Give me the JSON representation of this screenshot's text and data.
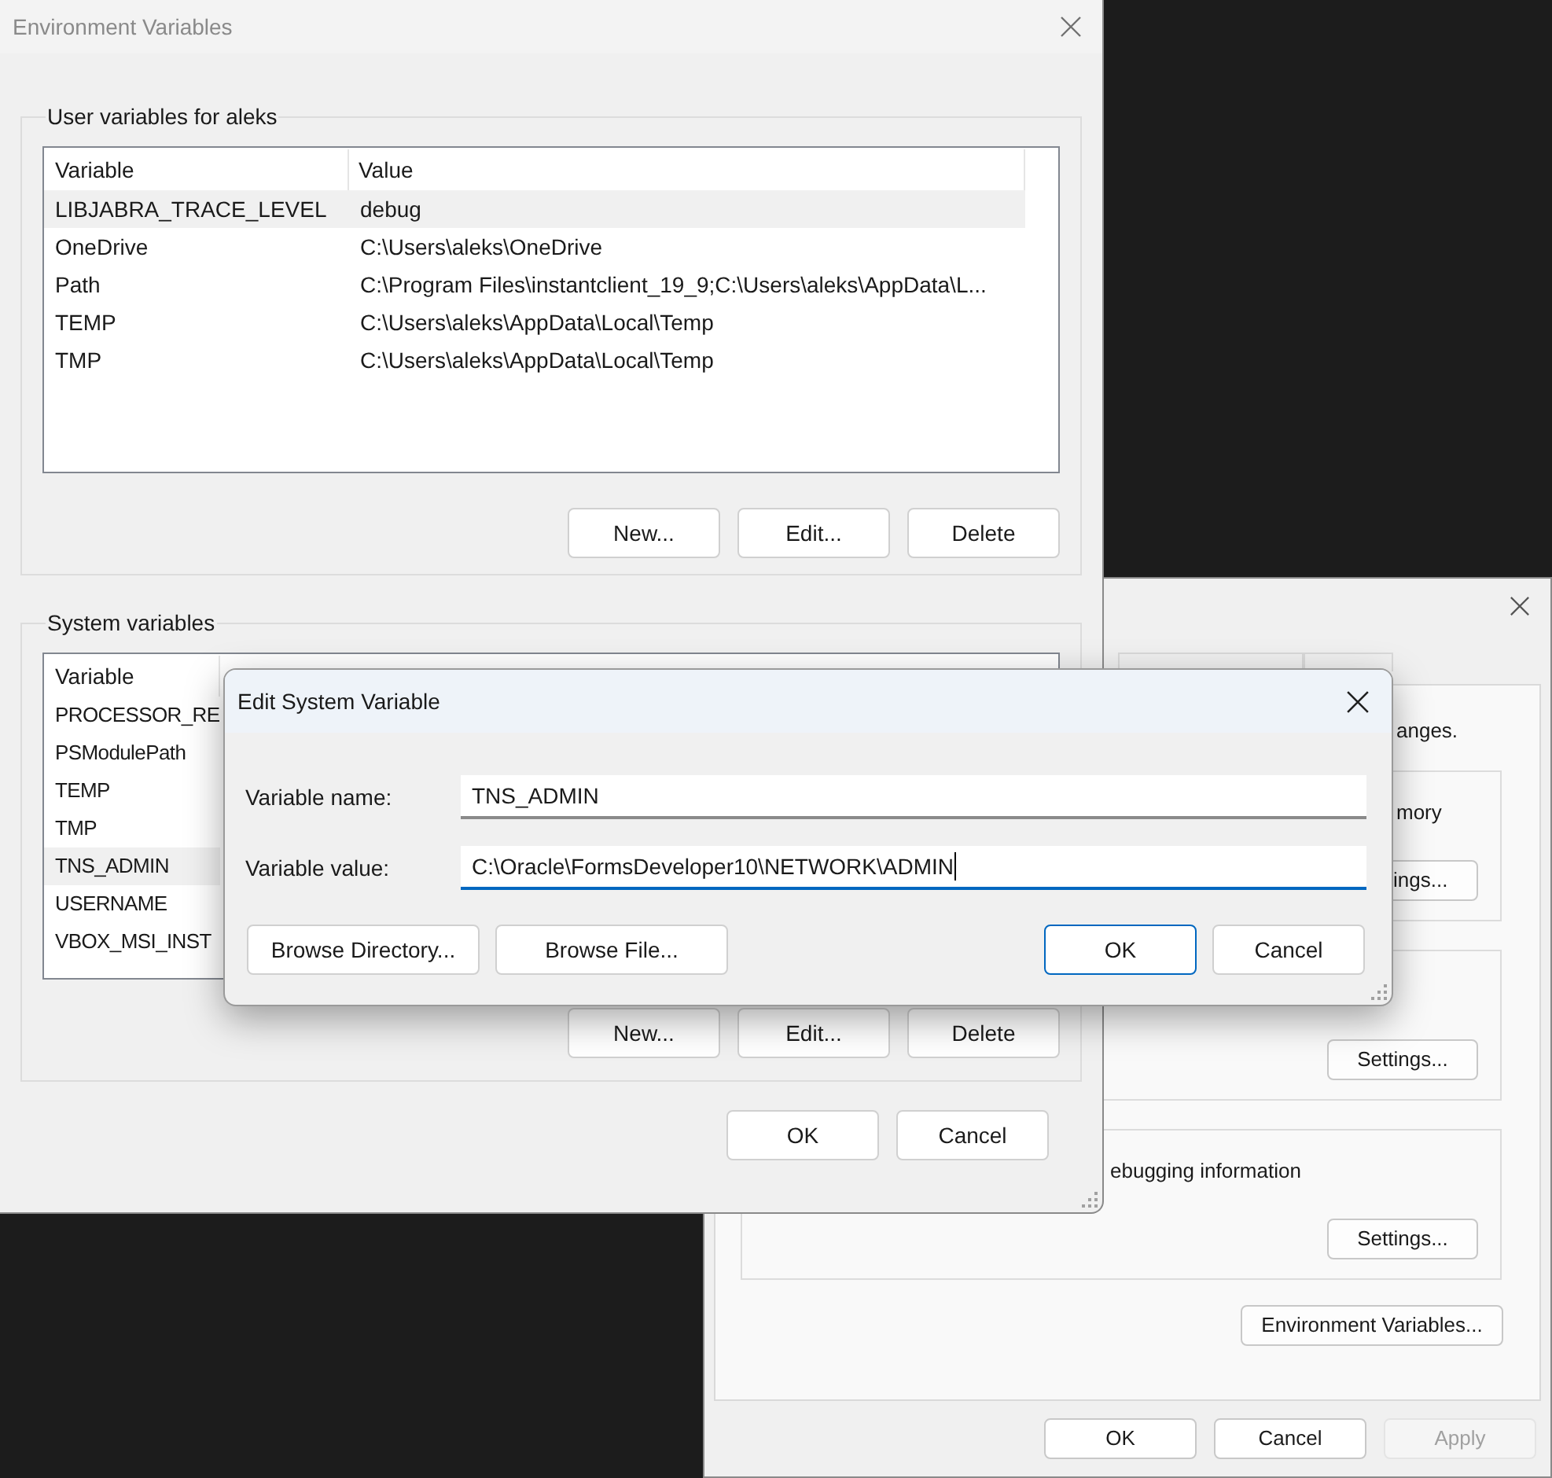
{
  "env_window": {
    "title": "Environment Variables",
    "user_group": {
      "label": "User variables for aleks",
      "columns": [
        "Variable",
        "Value"
      ],
      "rows": [
        {
          "variable": "LIBJABRA_TRACE_LEVEL",
          "value": "debug",
          "selected": true
        },
        {
          "variable": "OneDrive",
          "value": "C:\\Users\\aleks\\OneDrive",
          "selected": false
        },
        {
          "variable": "Path",
          "value": "C:\\Program Files\\instantclient_19_9;C:\\Users\\aleks\\AppData\\L...",
          "selected": false
        },
        {
          "variable": "TEMP",
          "value": "C:\\Users\\aleks\\AppData\\Local\\Temp",
          "selected": false
        },
        {
          "variable": "TMP",
          "value": "C:\\Users\\aleks\\AppData\\Local\\Temp",
          "selected": false
        }
      ],
      "buttons": [
        "New...",
        "Edit...",
        "Delete"
      ]
    },
    "system_group": {
      "label": "System variables",
      "columns": [
        "Variable"
      ],
      "rows": [
        {
          "variable": "PROCESSOR_RE",
          "selected": false
        },
        {
          "variable": "PSModulePath",
          "selected": false
        },
        {
          "variable": "TEMP",
          "selected": false
        },
        {
          "variable": "TMP",
          "selected": false
        },
        {
          "variable": "TNS_ADMIN",
          "selected": true
        },
        {
          "variable": "USERNAME",
          "selected": false
        },
        {
          "variable": "VBOX_MSI_INST",
          "selected": false
        }
      ],
      "buttons": [
        "New...",
        "Edit...",
        "Delete"
      ]
    },
    "buttons": [
      "OK",
      "Cancel"
    ]
  },
  "back_window": {
    "intro_text": "anges.",
    "groups": [
      {
        "text": "mory",
        "button": "ings..."
      },
      {
        "button": "Settings..."
      },
      {
        "text": "ebugging information",
        "button": "Settings..."
      }
    ],
    "env_button": "Environment Variables...",
    "buttons": [
      {
        "label": "OK",
        "disabled": false
      },
      {
        "label": "Cancel",
        "disabled": false
      },
      {
        "label": "Apply",
        "disabled": true
      }
    ]
  },
  "edit_dialog": {
    "title": "Edit System Variable",
    "fields": [
      {
        "label": "Variable name:",
        "value": "TNS_ADMIN",
        "focused": false
      },
      {
        "label": "Variable value:",
        "value": "C:\\Oracle\\FormsDeveloper10\\NETWORK\\ADMIN",
        "focused": true
      }
    ],
    "browse_buttons": [
      "Browse Directory...",
      "Browse File..."
    ],
    "buttons": [
      {
        "label": "OK",
        "default": true
      },
      {
        "label": "Cancel",
        "default": false
      }
    ]
  }
}
